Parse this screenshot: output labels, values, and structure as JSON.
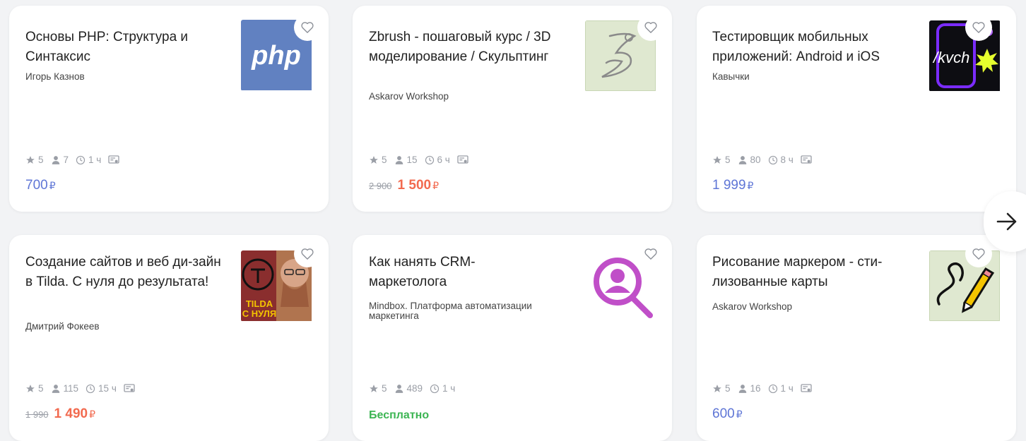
{
  "courses": [
    {
      "title": "Основы PHP: Структура и Синтаксис",
      "author": "Игорь Казнов",
      "rating": "5",
      "students": "7",
      "duration": "1 ч",
      "price": "700",
      "currency": "₽",
      "thumb_text": "php",
      "thumb_color": "#6181c1"
    },
    {
      "title": "Zbrush - пошаговый курс / 3D моделирование / Скульптинг",
      "author": "Askarov Workshop",
      "rating": "5",
      "students": "15",
      "duration": "6 ч",
      "old_price": "2 900",
      "sale_price": "1 500",
      "currency": "₽",
      "thumb_color": "#dfe8d0"
    },
    {
      "title": "Тестировщик мобильных приложений: Android и iOS",
      "author": "Кавычки",
      "rating": "5",
      "students": "80",
      "duration": "8 ч",
      "price": "1 999",
      "currency": "₽",
      "thumb_text": "/kvch",
      "thumb_color": "#0d0d12"
    },
    {
      "title": "Создание сайтов и веб ди-зайн в Tilda. С нуля до результата!",
      "author": "Дмитрий Фокеев",
      "rating": "5",
      "students": "115",
      "duration": "15 ч",
      "old_price": "1 990",
      "sale_price": "1 490",
      "currency": "₽",
      "thumb_text_1": "TILDA",
      "thumb_text_2": "С НУЛЯ",
      "thumb_color": "#8a2e2e"
    },
    {
      "title": "Как нанять CRM-маркетолога",
      "author": "Mindbox. Платформа автоматизации маркетинга",
      "rating": "5",
      "students": "489",
      "duration": "1 ч",
      "free_label": "Бесплатно",
      "thumb_color": "#c04fc8"
    },
    {
      "title": "Рисование маркером - сти-лизованные карты",
      "author": "Askarov Workshop",
      "rating": "5",
      "students": "16",
      "duration": "1 ч",
      "price": "600",
      "currency": "₽",
      "thumb_color": "#dfe8d0"
    }
  ],
  "colors": {
    "price": "#5f76d6",
    "sale": "#f26a4f",
    "free": "#3cb553",
    "muted": "#9a9ea6"
  }
}
